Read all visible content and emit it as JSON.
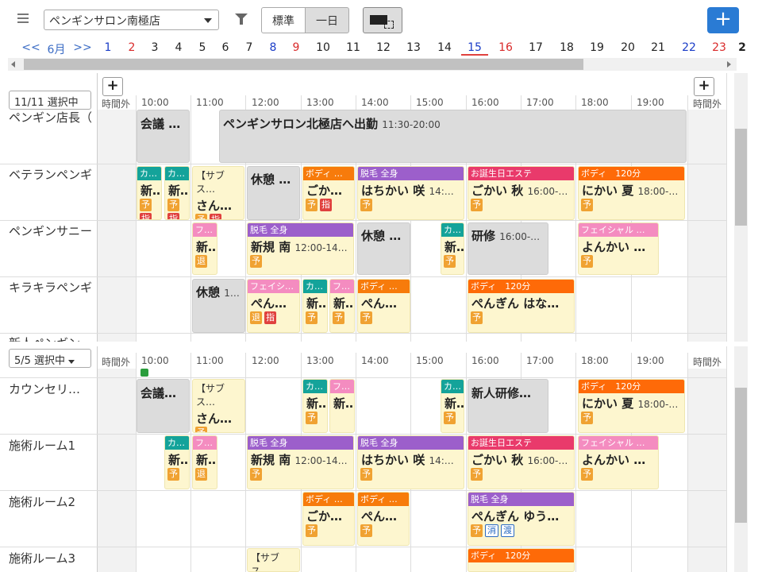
{
  "toolbar": {
    "store_name": "ペンギンサロン南極店",
    "view_standard": "標準",
    "view_day": "一日",
    "add_label": "+"
  },
  "date_nav": {
    "prev": "<<",
    "month": "6月",
    "next": ">>",
    "days": [
      "1",
      "2",
      "3",
      "4",
      "5",
      "6",
      "7",
      "8",
      "9",
      "10",
      "11",
      "12",
      "13",
      "14",
      "15",
      "16",
      "17",
      "18",
      "19",
      "20",
      "21",
      "22",
      "23",
      "2"
    ]
  },
  "staff_section": {
    "selector": "11/11 選択中",
    "add": "+",
    "out_label": "時間外",
    "times": [
      "10:00",
      "11:00",
      "12:00",
      "13:00",
      "14:00",
      "15:00",
      "16:00",
      "17:00",
      "18:00",
      "19:00"
    ],
    "rows": [
      "ペンギン店長（",
      "ベテランペンギ",
      "ペンギンサニー",
      "キラキラペンギ",
      "新人ペンギン"
    ]
  },
  "room_section": {
    "selector": "5/5 選択中",
    "out_label": "時間外",
    "times": [
      "10:00",
      "11:00",
      "12:00",
      "13:00",
      "14:00",
      "15:00",
      "16:00",
      "17:00",
      "18:00",
      "19:00"
    ],
    "rows": [
      "カウンセリ…",
      "施術ルーム1",
      "施術ルーム2",
      "施術ルーム3"
    ]
  },
  "events": {
    "s1_meeting": "会議 …",
    "s1_out": "ペンギンサロン北極店へ出勤",
    "s1_out_time": "11:30-20:00",
    "s2_k1_tag": "カ…",
    "s2_k1_name": "新…",
    "s2_k2_tag": "カ…",
    "s2_k2_name": "新…",
    "s2_sub": "【サブス…",
    "s2_sub_name": "さん…",
    "s2_rest": "休憩 …",
    "s2_body_tag": "ボディ …",
    "s2_body_name": "ごか…",
    "s2_hair_tag": "脱毛 全身",
    "s2_hair_name": "はちかい 咲",
    "s2_hair_time": "14:…",
    "s2_bday_tag": "お誕生日エステ",
    "s2_bday_name": "ごかい 秋",
    "s2_bday_time": "16:00-…",
    "s2_body2_tag": "ボディ　120分",
    "s2_body2_name": "にかい 夏",
    "s2_body2_time": "18:00-…",
    "s3_f_tag": "フ…",
    "s3_f_name": "新…",
    "s3_hair_tag": "脱毛 全身",
    "s3_hair_name": "新規 南",
    "s3_hair_time": "12:00-14…",
    "s3_rest": "休憩 …",
    "s3_k_tag": "カ…",
    "s3_k_name": "新…",
    "s3_train": "研修",
    "s3_train_time": "16:00-…",
    "s3_face_tag": "フェイシャル …",
    "s3_face_name": "よんかい …",
    "s4_rest": "休憩",
    "s4_rest_time": "1…",
    "s4_face_tag": "フェイシ…",
    "s4_face_name": "ぺん…",
    "s4_k_tag": "カ…",
    "s4_k_name": "新…",
    "s4_f_tag": "フ…",
    "s4_f_name": "新…",
    "s4_body_tag": "ボディ …",
    "s4_body_name": "ぺん…",
    "s4_body2_tag": "ボディ　120分",
    "s4_body2_name": "ぺんぎん はな…",
    "r1_meeting": "会議…",
    "r1_sub": "【サブス…",
    "r1_sub_name": "さん…",
    "r1_k_tag": "カ…",
    "r1_k_name": "新…",
    "r1_f_tag": "フ…",
    "r1_f_name": "新…",
    "r1_k2_tag": "カ…",
    "r1_k2_name": "新…",
    "r1_train": "新人研修…",
    "r1_body_tag": "ボディ　120分",
    "r1_body_name": "にかい 夏",
    "r1_body_time": "18:00-…",
    "r2_k_tag": "カ…",
    "r2_k_name": "新…",
    "r2_f_tag": "フ…",
    "r2_f_name": "新…",
    "r2_hair_tag": "脱毛 全身",
    "r2_hair_name": "新規 南",
    "r2_hair_time": "12:00-14…",
    "r2_hair2_tag": "脱毛 全身",
    "r2_hair2_name": "はちかい 咲",
    "r2_hair2_time": "14:…",
    "r2_bday_tag": "お誕生日エステ",
    "r2_bday_name": "ごかい 秋",
    "r2_bday_time": "16:00-…",
    "r2_face_tag": "フェイシャル …",
    "r2_face_name": "よんかい …",
    "r3_body_tag": "ボディ …",
    "r3_body_name": "ごか…",
    "r3_body2_tag": "ボディ …",
    "r3_body2_name": "ぺん…",
    "r3_hair_tag": "脱毛 全身",
    "r3_hair_name": "ぺんぎん ゆう…",
    "r4_sub": "【サブス…",
    "r4_body_tag": "ボディ　120分"
  },
  "badges": {
    "yo": "予",
    "shi": "指",
    "gen": "退",
    "sho": "消",
    "to": "渡"
  },
  "colors": {
    "accent": "#2a7bd4",
    "today_underline": "#e0413e"
  }
}
